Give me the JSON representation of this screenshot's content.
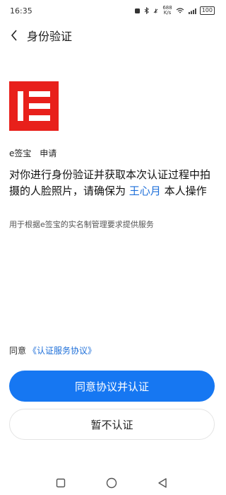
{
  "status_bar": {
    "time": "16:35",
    "net_speed": "688",
    "net_unit": "K/s",
    "battery": "100"
  },
  "header": {
    "title": "身份验证"
  },
  "app": {
    "name": "e签宝",
    "action": "申请"
  },
  "main": {
    "text_part1": "对你进行身份验证并获取本次认证过程中拍摄的人脸照片，请确保为",
    "highlight_name": "王心月",
    "text_part2": "本人操作",
    "subtext": "用于根据e签宝的实名制管理要求提供服务"
  },
  "agreement": {
    "prefix": "同意",
    "link": "《认证服务协议》"
  },
  "buttons": {
    "primary_label": "同意协议并认证",
    "secondary_label": "暂不认证"
  },
  "colors": {
    "brand_red": "#e8201b",
    "accent_blue": "#1677f2"
  }
}
